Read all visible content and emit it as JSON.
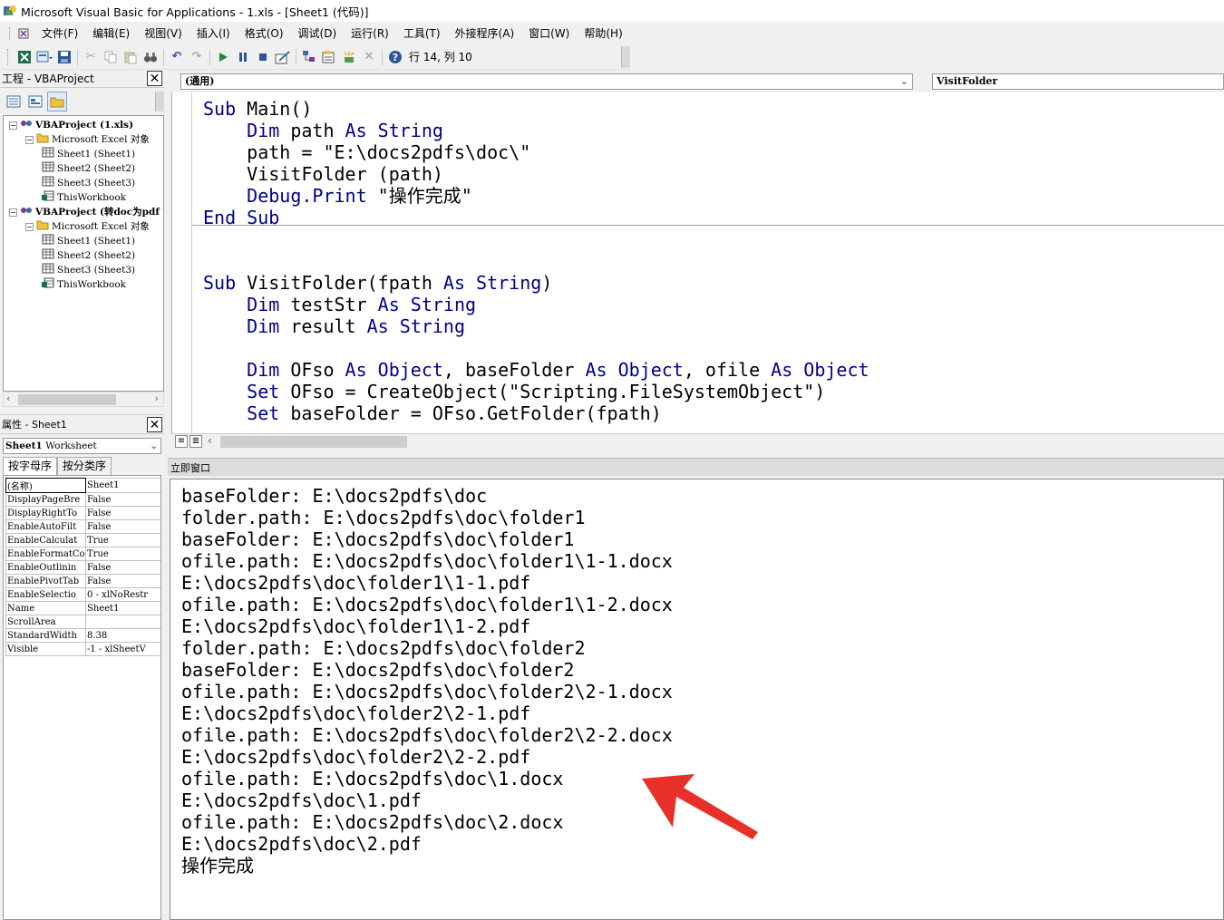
{
  "window": {
    "title": "Microsoft Visual Basic for Applications - 1.xls - [Sheet1 (代码)]"
  },
  "menu": [
    "文件(F)",
    "编辑(E)",
    "视图(V)",
    "插入(I)",
    "格式(O)",
    "调试(D)",
    "运行(R)",
    "工具(T)",
    "外接程序(A)",
    "窗口(W)",
    "帮助(H)"
  ],
  "toolbar": {
    "position_text": "行 14, 列 10"
  },
  "project": {
    "title": "工程 - VBAProject",
    "tree": [
      {
        "label": "VBAProject (1.xls)",
        "level": 0,
        "bold": true,
        "expander": "−",
        "icon": "vba-project-icon"
      },
      {
        "label": "Microsoft Excel 对象",
        "level": 1,
        "bold": false,
        "expander": "−",
        "icon": "folder-icon"
      },
      {
        "label": "Sheet1 (Sheet1)",
        "level": 2,
        "bold": false,
        "expander": "",
        "icon": "sheet-icon"
      },
      {
        "label": "Sheet2 (Sheet2)",
        "level": 2,
        "bold": false,
        "expander": "",
        "icon": "sheet-icon"
      },
      {
        "label": "Sheet3 (Sheet3)",
        "level": 2,
        "bold": false,
        "expander": "",
        "icon": "sheet-icon"
      },
      {
        "label": "ThisWorkbook",
        "level": 2,
        "bold": false,
        "expander": "",
        "icon": "workbook-icon"
      },
      {
        "label": "VBAProject (转doc为pdf",
        "level": 0,
        "bold": true,
        "expander": "−",
        "icon": "vba-project-icon"
      },
      {
        "label": "Microsoft Excel 对象",
        "level": 1,
        "bold": false,
        "expander": "−",
        "icon": "folder-icon"
      },
      {
        "label": "Sheet1 (Sheet1)",
        "level": 2,
        "bold": false,
        "expander": "",
        "icon": "sheet-icon"
      },
      {
        "label": "Sheet2 (Sheet2)",
        "level": 2,
        "bold": false,
        "expander": "",
        "icon": "sheet-icon"
      },
      {
        "label": "Sheet3 (Sheet3)",
        "level": 2,
        "bold": false,
        "expander": "",
        "icon": "sheet-icon"
      },
      {
        "label": "ThisWorkbook",
        "level": 2,
        "bold": false,
        "expander": "",
        "icon": "workbook-icon"
      }
    ]
  },
  "properties": {
    "title": "属性 - Sheet1",
    "object_select": {
      "name": "Sheet1",
      "type": "Worksheet"
    },
    "tabs": [
      "按字母序",
      "按分类序"
    ],
    "rows": [
      [
        "(名称)",
        "Sheet1"
      ],
      [
        "DisplayPageBre",
        "False"
      ],
      [
        "DisplayRightTo",
        "False"
      ],
      [
        "EnableAutoFilt",
        "False"
      ],
      [
        "EnableCalculat",
        "True"
      ],
      [
        "EnableFormatCo",
        "True"
      ],
      [
        "EnableOutlinin",
        "False"
      ],
      [
        "EnablePivotTab",
        "False"
      ],
      [
        "EnableSelectio",
        "0 - xlNoRestr"
      ],
      [
        "Name",
        "Sheet1"
      ],
      [
        "ScrollArea",
        ""
      ],
      [
        "StandardWidth",
        "8.38"
      ],
      [
        "Visible",
        "-1 - xlSheetV"
      ]
    ]
  },
  "code": {
    "object_dropdown": "(通用)",
    "procedure_dropdown": "VisitFolder",
    "section1": [
      [
        [
          "kw",
          "Sub"
        ],
        [
          "t",
          " Main()"
        ]
      ],
      [
        [
          "t",
          "    "
        ],
        [
          "kw",
          "Dim"
        ],
        [
          "t",
          " path "
        ],
        [
          "kw",
          "As String"
        ]
      ],
      [
        [
          "t",
          "    path = \"E:\\docs2pdfs\\doc\\\""
        ]
      ],
      [
        [
          "t",
          "    VisitFolder (path)"
        ]
      ],
      [
        [
          "t",
          "    "
        ],
        [
          "kw",
          "Debug.Print"
        ],
        [
          "t",
          " \"操作完成\""
        ]
      ],
      [
        [
          "kw",
          "End Sub"
        ]
      ]
    ],
    "section2": [
      [
        [
          "kw",
          "Sub"
        ],
        [
          "t",
          " VisitFolder(fpath "
        ],
        [
          "kw",
          "As String"
        ],
        [
          "t",
          ")"
        ]
      ],
      [
        [
          "t",
          "    "
        ],
        [
          "kw",
          "Dim"
        ],
        [
          "t",
          " testStr "
        ],
        [
          "kw",
          "As String"
        ]
      ],
      [
        [
          "t",
          "    "
        ],
        [
          "kw",
          "Dim"
        ],
        [
          "t",
          " result "
        ],
        [
          "kw",
          "As String"
        ]
      ],
      [
        [
          "t",
          ""
        ]
      ],
      [
        [
          "t",
          "    "
        ],
        [
          "kw",
          "Dim"
        ],
        [
          "t",
          " OFso "
        ],
        [
          "kw",
          "As Object"
        ],
        [
          "t",
          ", baseFolder "
        ],
        [
          "kw",
          "As Object"
        ],
        [
          "t",
          ", ofile "
        ],
        [
          "kw",
          "As Object"
        ]
      ],
      [
        [
          "t",
          "    "
        ],
        [
          "kw",
          "Set"
        ],
        [
          "t",
          " OFso = CreateObject(\"Scripting.FileSystemObject\")"
        ]
      ],
      [
        [
          "t",
          "    "
        ],
        [
          "kw",
          "Set"
        ],
        [
          "t",
          " baseFolder = OFso.GetFolder(fpath)"
        ]
      ]
    ]
  },
  "immediate": {
    "title": "立即窗口",
    "lines": [
      "baseFolder: E:\\docs2pdfs\\doc",
      "folder.path: E:\\docs2pdfs\\doc\\folder1",
      "baseFolder: E:\\docs2pdfs\\doc\\folder1",
      "ofile.path: E:\\docs2pdfs\\doc\\folder1\\1-1.docx",
      "E:\\docs2pdfs\\doc\\folder1\\1-1.pdf",
      "ofile.path: E:\\docs2pdfs\\doc\\folder1\\1-2.docx",
      "E:\\docs2pdfs\\doc\\folder1\\1-2.pdf",
      "folder.path: E:\\docs2pdfs\\doc\\folder2",
      "baseFolder: E:\\docs2pdfs\\doc\\folder2",
      "ofile.path: E:\\docs2pdfs\\doc\\folder2\\2-1.docx",
      "E:\\docs2pdfs\\doc\\folder2\\2-1.pdf",
      "ofile.path: E:\\docs2pdfs\\doc\\folder2\\2-2.docx",
      "E:\\docs2pdfs\\doc\\folder2\\2-2.pdf",
      "ofile.path: E:\\docs2pdfs\\doc\\1.docx",
      "E:\\docs2pdfs\\doc\\1.pdf",
      "ofile.path: E:\\docs2pdfs\\doc\\2.docx",
      "E:\\docs2pdfs\\doc\\2.pdf",
      "操作完成"
    ]
  },
  "colors": {
    "keyword": "#00008b",
    "annotation_arrow": "#e8302a"
  }
}
